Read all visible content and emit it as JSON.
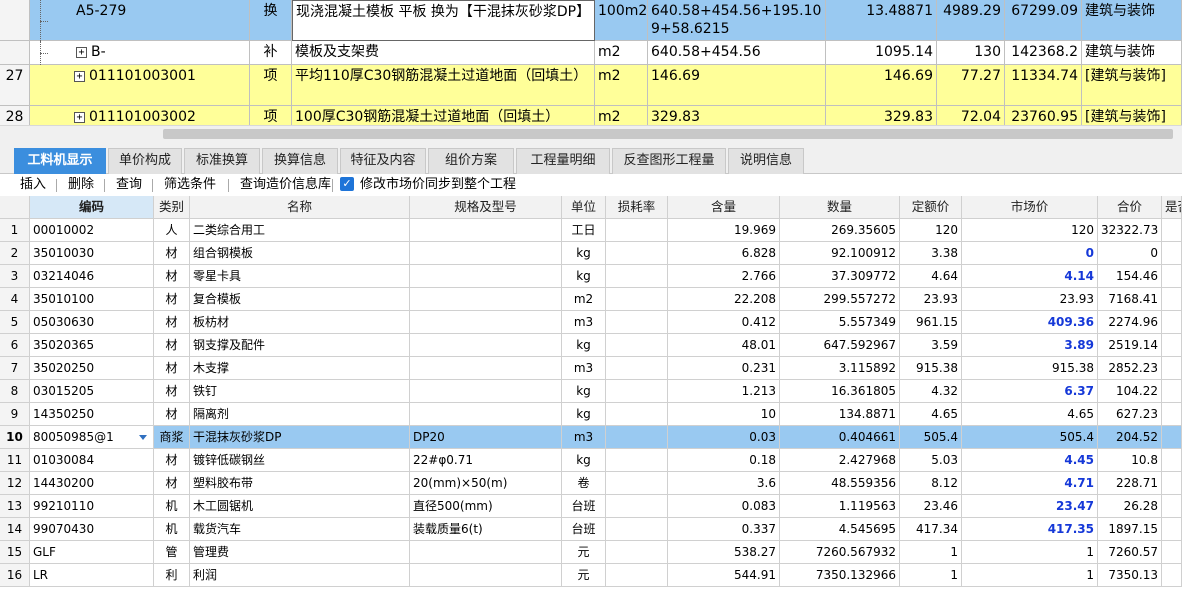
{
  "upper_rows": [
    {
      "row_no": "",
      "code": "A5-279",
      "type": "换",
      "name": "现浇混凝土模板 平板  换为【干混抹灰砂浆DP】",
      "unit": "100m2",
      "expr": "640.58+454.56+195.109+58.6215",
      "qty": "13.48871",
      "price": "4989.29",
      "total": "67299.09",
      "major": "建筑与装饰"
    },
    {
      "row_no": "",
      "code": "B-",
      "type": "补",
      "name": "模板及支架费",
      "unit": "m2",
      "expr": "640.58+454.56",
      "qty": "1095.14",
      "price": "130",
      "total": "142368.2",
      "major": "建筑与装饰"
    },
    {
      "row_no": "27",
      "code": "011101003001",
      "type": "项",
      "name": "平均110厚C30钢筋混凝土过道地面（回填土）",
      "unit": "m2",
      "expr": "146.69",
      "qty": "146.69",
      "price": "77.27",
      "total": "11334.74",
      "major": "[建筑与装饰]"
    },
    {
      "row_no": "28",
      "code": "011101003002",
      "type": "项",
      "name": "100厚C30钢筋混凝土过道地面（回填土）",
      "unit": "m2",
      "expr": "329.83",
      "qty": "329.83",
      "price": "72.04",
      "total": "23760.95",
      "major": "[建筑与装饰]"
    }
  ],
  "expand_symbol": "+",
  "tabs": [
    "工料机显示",
    "单价构成",
    "标准换算",
    "换算信息",
    "特征及内容",
    "组价方案",
    "工程量明细",
    "反查图形工程量",
    "说明信息"
  ],
  "toolbar": {
    "insert": "插入",
    "delete": "删除",
    "query": "查询",
    "filter": "筛选条件",
    "query_price_db": "查询造价信息库",
    "sync_label": "修改市场价同步到整个工程",
    "check_mark": "✓"
  },
  "columns": [
    "编码",
    "类别",
    "名称",
    "规格及型号",
    "单位",
    "损耗率",
    "含量",
    "数量",
    "定额价",
    "市场价",
    "合价",
    "是否"
  ],
  "rows": [
    {
      "n": "1",
      "code": "00010002",
      "cat": "人",
      "name": "二类综合用工",
      "spec": "",
      "unit": "工日",
      "loss": "",
      "content": "19.969",
      "qty": "269.35605",
      "quota": "120",
      "market": "120",
      "total": "32322.73",
      "mblue": false
    },
    {
      "n": "2",
      "code": "35010030",
      "cat": "材",
      "name": "组合钢模板",
      "spec": "",
      "unit": "kg",
      "loss": "",
      "content": "6.828",
      "qty": "92.100912",
      "quota": "3.38",
      "market": "0",
      "total": "0",
      "mblue": true
    },
    {
      "n": "3",
      "code": "03214046",
      "cat": "材",
      "name": "零星卡具",
      "spec": "",
      "unit": "kg",
      "loss": "",
      "content": "2.766",
      "qty": "37.309772",
      "quota": "4.64",
      "market": "4.14",
      "total": "154.46",
      "mblue": true
    },
    {
      "n": "4",
      "code": "35010100",
      "cat": "材",
      "name": "复合模板",
      "spec": "",
      "unit": "m2",
      "loss": "",
      "content": "22.208",
      "qty": "299.557272",
      "quota": "23.93",
      "market": "23.93",
      "total": "7168.41",
      "mblue": false
    },
    {
      "n": "5",
      "code": "05030630",
      "cat": "材",
      "name": "板枋材",
      "spec": "",
      "unit": "m3",
      "loss": "",
      "content": "0.412",
      "qty": "5.557349",
      "quota": "961.15",
      "market": "409.36",
      "total": "2274.96",
      "mblue": true
    },
    {
      "n": "6",
      "code": "35020365",
      "cat": "材",
      "name": "钢支撑及配件",
      "spec": "",
      "unit": "kg",
      "loss": "",
      "content": "48.01",
      "qty": "647.592967",
      "quota": "3.59",
      "market": "3.89",
      "total": "2519.14",
      "mblue": true
    },
    {
      "n": "7",
      "code": "35020250",
      "cat": "材",
      "name": "木支撑",
      "spec": "",
      "unit": "m3",
      "loss": "",
      "content": "0.231",
      "qty": "3.115892",
      "quota": "915.38",
      "market": "915.38",
      "total": "2852.23",
      "mblue": false
    },
    {
      "n": "8",
      "code": "03015205",
      "cat": "材",
      "name": "铁钉",
      "spec": "",
      "unit": "kg",
      "loss": "",
      "content": "1.213",
      "qty": "16.361805",
      "quota": "4.32",
      "market": "6.37",
      "total": "104.22",
      "mblue": true
    },
    {
      "n": "9",
      "code": "14350250",
      "cat": "材",
      "name": "隔离剂",
      "spec": "",
      "unit": "kg",
      "loss": "",
      "content": "10",
      "qty": "134.8871",
      "quota": "4.65",
      "market": "4.65",
      "total": "627.23",
      "mblue": false
    },
    {
      "n": "10",
      "code": "80050985@1",
      "cat": "商浆",
      "name": "干混抹灰砂浆DP",
      "spec": "DP20",
      "unit": "m3",
      "loss": "",
      "content": "0.03",
      "qty": "0.404661",
      "quota": "505.4",
      "market": "505.4",
      "total": "204.52",
      "mblue": false,
      "selected": true
    },
    {
      "n": "11",
      "code": "01030084",
      "cat": "材",
      "name": "镀锌低碳钢丝",
      "spec": "22#φ0.71",
      "unit": "kg",
      "loss": "",
      "content": "0.18",
      "qty": "2.427968",
      "quota": "5.03",
      "market": "4.45",
      "total": "10.8",
      "mblue": true
    },
    {
      "n": "12",
      "code": "14430200",
      "cat": "材",
      "name": "塑料胶布带",
      "spec": "20(mm)×50(m)",
      "unit": "卷",
      "loss": "",
      "content": "3.6",
      "qty": "48.559356",
      "quota": "8.12",
      "market": "4.71",
      "total": "228.71",
      "mblue": true
    },
    {
      "n": "13",
      "code": "99210110",
      "cat": "机",
      "name": "木工圆锯机",
      "spec": "直径500(mm)",
      "unit": "台班",
      "loss": "",
      "content": "0.083",
      "qty": "1.119563",
      "quota": "23.46",
      "market": "23.47",
      "total": "26.28",
      "mblue": true
    },
    {
      "n": "14",
      "code": "99070430",
      "cat": "机",
      "name": "载货汽车",
      "spec": "装载质量6(t)",
      "unit": "台班",
      "loss": "",
      "content": "0.337",
      "qty": "4.545695",
      "quota": "417.34",
      "market": "417.35",
      "total": "1897.15",
      "mblue": true
    },
    {
      "n": "15",
      "code": "GLF",
      "cat": "管",
      "name": "管理费",
      "spec": "",
      "unit": "元",
      "loss": "",
      "content": "538.27",
      "qty": "7260.567932",
      "quota": "1",
      "market": "1",
      "total": "7260.57",
      "mblue": false
    },
    {
      "n": "16",
      "code": "LR",
      "cat": "利",
      "name": "利润",
      "spec": "",
      "unit": "元",
      "loss": "",
      "content": "544.91",
      "qty": "7350.132966",
      "quota": "1",
      "market": "1",
      "total": "7350.13",
      "mblue": false
    }
  ],
  "colors": {
    "upper_yellow": "#ffff99",
    "upper_blue": "#99c9f1",
    "tab_active": "#3b8ede",
    "selected_row": "#99c9f1",
    "blue_text": "#1538d8"
  }
}
